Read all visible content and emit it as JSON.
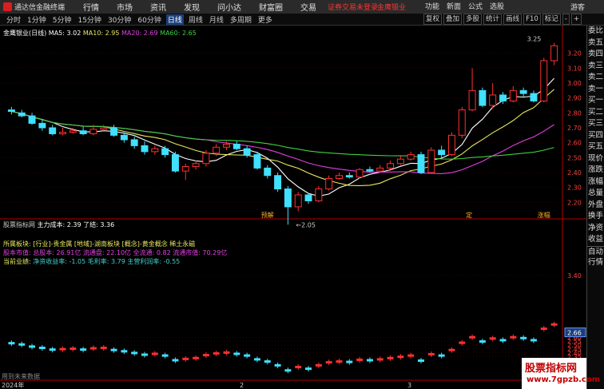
{
  "titlebar": {
    "app_title": "通达信金融终端",
    "menu": [
      "行情",
      "市场",
      "资讯",
      "发现",
      "问小达",
      "财富圈",
      "交易"
    ],
    "login_notice": "证券交易未登录",
    "login_notice2": "金鹰银业",
    "right_menu": [
      "功能",
      "新面",
      "公式",
      "选股"
    ],
    "guest": "游客"
  },
  "toolbar": {
    "periods": [
      "分时",
      "1分钟",
      "5分钟",
      "15分钟",
      "30分钟",
      "60分钟",
      "日线",
      "周线",
      "月线",
      "多周期",
      "更多"
    ],
    "active_period": "日线",
    "tools": [
      "复权",
      "叠加",
      "多股",
      "统计",
      "画线",
      "F10",
      "标记",
      "-",
      "+"
    ]
  },
  "main_legend": {
    "name": "金鹰银业(日线)",
    "ma5": "MA5: 3.02",
    "ma10": "MA10: 2.95",
    "ma20": "MA20: 2.69",
    "ma60": "MA60: 2.65"
  },
  "sub_legend": {
    "name": "股票指标网",
    "label": "主力成本: 2.39",
    "value2": "了结: 3.36"
  },
  "info_lines": {
    "line1": "所属板块: [行业]-贵金属 [地域]-湖南板块 [概念]-黄金概念 稀土永磁",
    "line2": "股本市值: 总股本: 26.91亿 流通盘: 22.10亿 全流通: 0.82 流通市值: 70.29亿",
    "line3a": "当前业绩:",
    "line3b": "净资收益率: -1.05 毛利率: 3.79 主营利润率: -0.55"
  },
  "no_data": "用到未来数据",
  "year_label": "2024年",
  "right_panel": [
    "委比",
    "卖五",
    "卖四",
    "卖三",
    "卖二",
    "卖一",
    "买一",
    "买二",
    "买三",
    "买四",
    "买五",
    "现价",
    "涨跌",
    "涨幅",
    "总量",
    "外盘",
    "换手",
    "净资",
    "收益",
    "自动",
    "行情"
  ],
  "watermark": {
    "line1": "股票指标网",
    "line2": "www.7gpzb.com"
  },
  "colors": {
    "up": "#ff3030",
    "down": "#40e0ff",
    "ma5": "#ffffff",
    "ma10": "#e8e860",
    "ma20": "#e040e0",
    "ma60": "#40d040"
  },
  "chart_data": [
    {
      "type": "candlestick",
      "title": "金鹰银业(日线)",
      "ylim": [
        2.1,
        3.3
      ],
      "yticks": [
        "3.20",
        "3.10",
        "3.00",
        "2.90",
        "2.80",
        "2.70",
        "2.60",
        "2.50",
        "2.40",
        "2.30",
        "2.20"
      ],
      "high_label": "3.25",
      "low_label": "2.05",
      "event_labels": [
        "预解",
        "定",
        "涨幅"
      ],
      "candles": [
        [
          2.82,
          2.81,
          2.84,
          2.79
        ],
        [
          2.8,
          2.78,
          2.82,
          2.77
        ],
        [
          2.78,
          2.73,
          2.8,
          2.72
        ],
        [
          2.73,
          2.7,
          2.76,
          2.68
        ],
        [
          2.7,
          2.66,
          2.72,
          2.65
        ],
        [
          2.66,
          2.67,
          2.7,
          2.65
        ],
        [
          2.67,
          2.68,
          2.7,
          2.66
        ],
        [
          2.68,
          2.66,
          2.71,
          2.65
        ],
        [
          2.66,
          2.69,
          2.72,
          2.65
        ],
        [
          2.69,
          2.7,
          2.72,
          2.68
        ],
        [
          2.7,
          2.65,
          2.72,
          2.64
        ],
        [
          2.65,
          2.62,
          2.67,
          2.6
        ],
        [
          2.62,
          2.58,
          2.64,
          2.56
        ],
        [
          2.58,
          2.54,
          2.61,
          2.52
        ],
        [
          2.54,
          2.56,
          2.58,
          2.52
        ],
        [
          2.56,
          2.52,
          2.58,
          2.5
        ],
        [
          2.52,
          2.41,
          2.54,
          2.4
        ],
        [
          2.41,
          2.44,
          2.46,
          2.35
        ],
        [
          2.44,
          2.46,
          2.48,
          2.42
        ],
        [
          2.46,
          2.53,
          2.55,
          2.44
        ],
        [
          2.53,
          2.57,
          2.59,
          2.51
        ],
        [
          2.57,
          2.59,
          2.61,
          2.55
        ],
        [
          2.59,
          2.56,
          2.61,
          2.55
        ],
        [
          2.56,
          2.52,
          2.58,
          2.5
        ],
        [
          2.52,
          2.43,
          2.54,
          2.42
        ],
        [
          2.43,
          2.38,
          2.45,
          2.36
        ],
        [
          2.38,
          2.29,
          2.4,
          2.27
        ],
        [
          2.29,
          2.17,
          2.31,
          2.05
        ],
        [
          2.17,
          2.25,
          2.27,
          2.14
        ],
        [
          2.25,
          2.21,
          2.26,
          2.19
        ],
        [
          2.21,
          2.29,
          2.31,
          2.2
        ],
        [
          2.29,
          2.36,
          2.38,
          2.28
        ],
        [
          2.36,
          2.38,
          2.4,
          2.35
        ],
        [
          2.38,
          2.37,
          2.4,
          2.36
        ],
        [
          2.37,
          2.42,
          2.43,
          2.36
        ],
        [
          2.42,
          2.41,
          2.44,
          2.4
        ],
        [
          2.41,
          2.43,
          2.45,
          2.4
        ],
        [
          2.43,
          2.46,
          2.48,
          2.42
        ],
        [
          2.46,
          2.49,
          2.51,
          2.45
        ],
        [
          2.49,
          2.52,
          2.54,
          2.48
        ],
        [
          2.52,
          2.4,
          2.54,
          2.39
        ],
        [
          2.4,
          2.55,
          2.57,
          2.39
        ],
        [
          2.55,
          2.52,
          2.58,
          2.5
        ],
        [
          2.52,
          2.65,
          2.67,
          2.51
        ],
        [
          2.65,
          2.82,
          2.84,
          2.63
        ],
        [
          2.82,
          2.95,
          3.1,
          2.81
        ],
        [
          2.95,
          2.85,
          2.97,
          2.84
        ],
        [
          2.85,
          2.92,
          3.0,
          2.83
        ],
        [
          2.92,
          2.88,
          2.94,
          2.86
        ],
        [
          2.88,
          2.95,
          2.98,
          2.87
        ],
        [
          2.95,
          2.93,
          2.97,
          2.91
        ],
        [
          2.93,
          2.88,
          2.95,
          2.87
        ],
        [
          2.88,
          3.15,
          3.17,
          2.87
        ],
        [
          3.15,
          3.25,
          3.27,
          3.12
        ]
      ]
    },
    {
      "type": "bar",
      "title": "股票指标网",
      "ylim": [
        2.15,
        3.45
      ],
      "yticks": [
        "3.40",
        "2.60",
        "2.55",
        "2.50",
        "2.45",
        "2.40",
        "2.35"
      ],
      "current_value": "2.66",
      "xlabels": [
        "2024年",
        "2",
        "3"
      ]
    }
  ]
}
